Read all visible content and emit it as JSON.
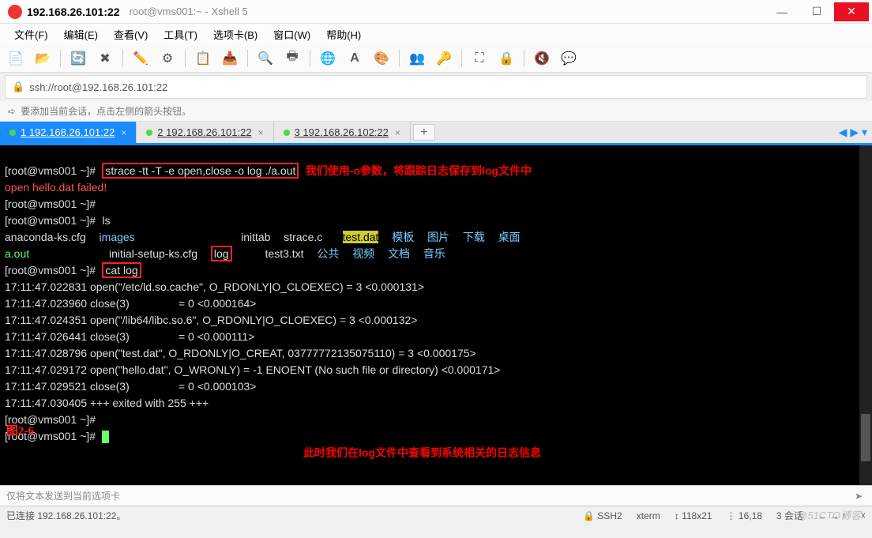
{
  "window": {
    "title_main": "192.168.26.101:22",
    "title_sub": "root@vms001:~ - Xshell 5"
  },
  "menu": {
    "file": "文件(F)",
    "edit": "编辑(E)",
    "view": "查看(V)",
    "tools": "工具(T)",
    "tabs": "选项卡(B)",
    "window": "窗口(W)",
    "help": "帮助(H)"
  },
  "address": {
    "url": "ssh://root@192.168.26.101:22"
  },
  "hint": {
    "text": "要添加当前会话，点击左侧的箭头按钮。"
  },
  "tabs": [
    {
      "label": "1 192.168.26.101:22",
      "active": true
    },
    {
      "label": "2 192.168.26.101:22",
      "active": false
    },
    {
      "label": "3 192.168.26.102:22",
      "active": false
    }
  ],
  "terminal": {
    "prompt": "[root@vms001 ~]#",
    "cmd_strace": "strace -tt -T -e open,close -o log ./a.out",
    "note_strace": "我们使用-o参数，将跟踪日志保存到log文件中",
    "fail_line": "open hello.dat failed!",
    "cmd_ls": "ls",
    "ls_row1": {
      "c0": "anaconda-ks.cfg",
      "c1": "images",
      "c2": "inittab",
      "c3": "strace.c",
      "c4": "test.dat",
      "c5": "模板",
      "c6": "图片",
      "c7": "下载",
      "c8": "桌面"
    },
    "ls_row2": {
      "c0": "a.out",
      "c1": "initial-setup-ks.cfg",
      "c2": "log",
      "c3": "test3.txt",
      "c4": "公共",
      "c5": "视频",
      "c6": "文档",
      "c7": "音乐"
    },
    "cmd_cat": "cat log",
    "log_lines": [
      "17:11:47.022831 open(\"/etc/ld.so.cache\", O_RDONLY|O_CLOEXEC) = 3 <0.000131>",
      "17:11:47.023960 close(3)                = 0 <0.000164>",
      "17:11:47.024351 open(\"/lib64/libc.so.6\", O_RDONLY|O_CLOEXEC) = 3 <0.000132>",
      "17:11:47.026441 close(3)                = 0 <0.000111>",
      "17:11:47.028796 open(\"test.dat\", O_RDONLY|O_CREAT, 03777772135075110) = 3 <0.000175>",
      "17:11:47.029172 open(\"hello.dat\", O_WRONLY) = -1 ENOENT (No such file or directory) <0.000171>",
      "17:11:47.029521 close(3)                = 0 <0.000103>",
      "17:11:47.030405 +++ exited with 255 +++"
    ],
    "note_bottom": "此时我们在log文件中查看到系统相关的日志信息",
    "figure_label": "图2-6"
  },
  "input_strip": {
    "placeholder": "仅将文本发送到当前选项卡"
  },
  "statusbar": {
    "conn": "已连接 192.168.26.101:22。",
    "ssh": "SSH2",
    "term": "xterm",
    "size": "118x21",
    "pos": "16,18",
    "sessions": "3 会话"
  },
  "watermark": "@51CTO博客"
}
